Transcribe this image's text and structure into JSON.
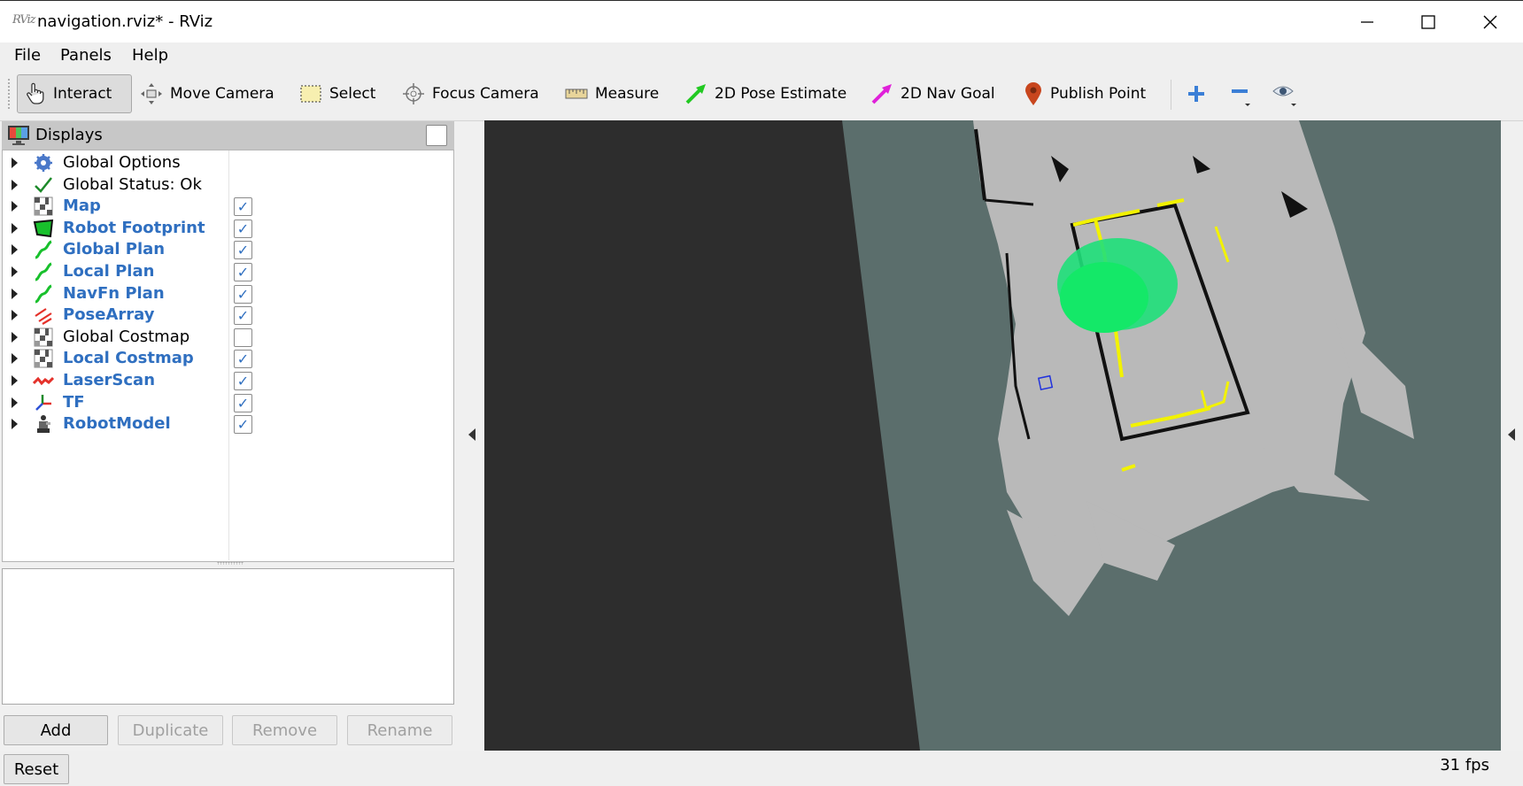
{
  "window": {
    "app_icon_text": "RViz",
    "title": "navigation.rviz* - RViz"
  },
  "menu": {
    "items": [
      {
        "label": "File"
      },
      {
        "label": "Panels"
      },
      {
        "label": "Help"
      }
    ]
  },
  "toolbar": {
    "tools": [
      {
        "label": "Interact",
        "icon": "hand-pointer-icon",
        "active": true
      },
      {
        "label": "Move Camera",
        "icon": "move-camera-icon",
        "active": false
      },
      {
        "label": "Select",
        "icon": "select-box-icon",
        "active": false
      },
      {
        "label": "Focus Camera",
        "icon": "crosshair-icon",
        "active": false
      },
      {
        "label": "Measure",
        "icon": "ruler-icon",
        "active": false
      },
      {
        "label": "2D Pose Estimate",
        "icon": "green-arrow-icon",
        "active": false
      },
      {
        "label": "2D Nav Goal",
        "icon": "magenta-arrow-icon",
        "active": false
      },
      {
        "label": "Publish Point",
        "icon": "map-pin-icon",
        "active": false
      }
    ],
    "extra_icons": [
      "plus-icon",
      "minus-icon",
      "eye-icon"
    ],
    "colors": {
      "pose_arrow": "#22c922",
      "goal_arrow": "#e021d9",
      "pin": "#c8461e",
      "tool_blue": "#3b7fd6"
    }
  },
  "displays_panel": {
    "title": "Displays",
    "items": [
      {
        "label": "Global Options",
        "icon": "gear-icon",
        "checkbox": null,
        "highlight": false
      },
      {
        "label": "Global Status: Ok",
        "icon": "checkmark-icon",
        "checkbox": null,
        "highlight": false
      },
      {
        "label": "Map",
        "icon": "grid-map-icon",
        "checkbox": true,
        "highlight": true
      },
      {
        "label": "Robot Footprint",
        "icon": "polygon-icon",
        "checkbox": true,
        "highlight": true
      },
      {
        "label": "Global Plan",
        "icon": "path-icon",
        "checkbox": true,
        "highlight": true
      },
      {
        "label": "Local Plan",
        "icon": "path-icon",
        "checkbox": true,
        "highlight": true
      },
      {
        "label": "NavFn Plan",
        "icon": "path-icon",
        "checkbox": true,
        "highlight": true
      },
      {
        "label": "PoseArray",
        "icon": "pose-array-icon",
        "checkbox": true,
        "highlight": true
      },
      {
        "label": "Global Costmap",
        "icon": "grid-map-icon",
        "checkbox": false,
        "highlight": false
      },
      {
        "label": "Local Costmap",
        "icon": "grid-map-icon",
        "checkbox": true,
        "highlight": true
      },
      {
        "label": "LaserScan",
        "icon": "laser-scan-icon",
        "checkbox": true,
        "highlight": true
      },
      {
        "label": "TF",
        "icon": "tf-axes-icon",
        "checkbox": true,
        "highlight": true
      },
      {
        "label": "RobotModel",
        "icon": "robot-icon",
        "checkbox": true,
        "highlight": true
      }
    ],
    "checkmark": "✓"
  },
  "buttons": {
    "add": "Add",
    "duplicate": "Duplicate",
    "remove": "Remove",
    "rename": "Rename",
    "reset": "Reset"
  },
  "status": {
    "fps": "31 fps"
  },
  "viewport": {
    "colors": {
      "background": "#5b6e6c",
      "dark_ground": "#2d2d2d",
      "free_space": "#b9b9b9",
      "walls": "#111111",
      "laser_scan": "#f2f200",
      "particle_cloud": "#1fe07a",
      "footprint": "#2233dd"
    }
  }
}
